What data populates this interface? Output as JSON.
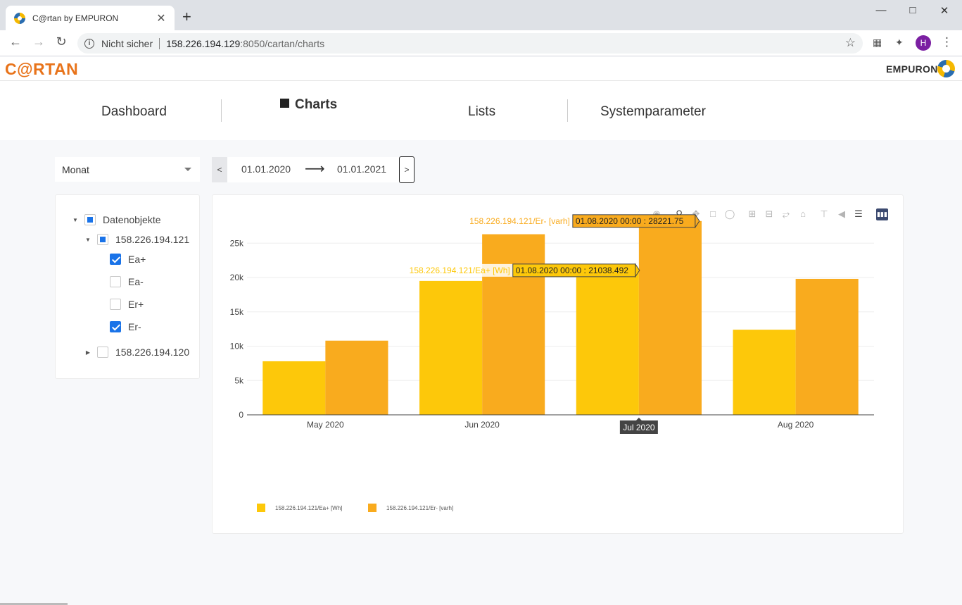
{
  "browser": {
    "tab_title": "C@rtan by EMPURON",
    "tab_close": "✕",
    "new_tab": "+",
    "security_label": "Nicht sicher",
    "url_host": "158.226.194.129",
    "url_rest": ":8050/cartan/charts",
    "profile_initial": "H"
  },
  "app": {
    "logo": "C@RTAN",
    "brand": "EMPURON",
    "nav": {
      "dashboard": "Dashboard",
      "charts": "Charts",
      "lists": "Lists",
      "systemparameter": "Systemparameter"
    }
  },
  "filters": {
    "period": "Monat",
    "prev": "<",
    "next": ">",
    "from": "01.01.2020",
    "arrow": "⟶",
    "to": "01.01.2021"
  },
  "tree": {
    "root": "Datenobjekte",
    "node1": "158.226.194.121",
    "ea_plus": "Ea+",
    "ea_minus": "Ea-",
    "er_plus": "Er+",
    "er_minus": "Er-",
    "node2": "158.226.194.120"
  },
  "colors": {
    "series_ea": "#fdc80a",
    "series_er": "#f9ab1e",
    "accent": "#1a73e8",
    "logo_orange": "#e8731a"
  },
  "chart_data": {
    "type": "bar",
    "categories": [
      "May 2020",
      "Jun 2020",
      "Jul 2020",
      "Aug 2020"
    ],
    "series": [
      {
        "name": "158.226.194.121/Ea+ [Wh]",
        "values": [
          7800,
          19500,
          21038.492,
          12400
        ]
      },
      {
        "name": "158.226.194.121/Er- [varh]",
        "values": [
          10800,
          26300,
          28221.75,
          19800
        ]
      }
    ],
    "y_ticks": [
      0,
      5000,
      10000,
      15000,
      20000,
      25000
    ],
    "y_tick_labels": [
      "0",
      "5k",
      "10k",
      "15k",
      "20k",
      "25k"
    ],
    "ylim": [
      0,
      28000
    ],
    "grid": true,
    "legend_placement": "bottom-left",
    "hover": {
      "x_label": "Jul 2020",
      "series_labels": [
        "158.226.194.121/Ea+ [Wh]",
        "158.226.194.121/Er- [varh]"
      ],
      "values": [
        "01.08.2020 00:00 : 21038.492",
        "01.08.2020 00:00 : 28221.75"
      ]
    }
  }
}
